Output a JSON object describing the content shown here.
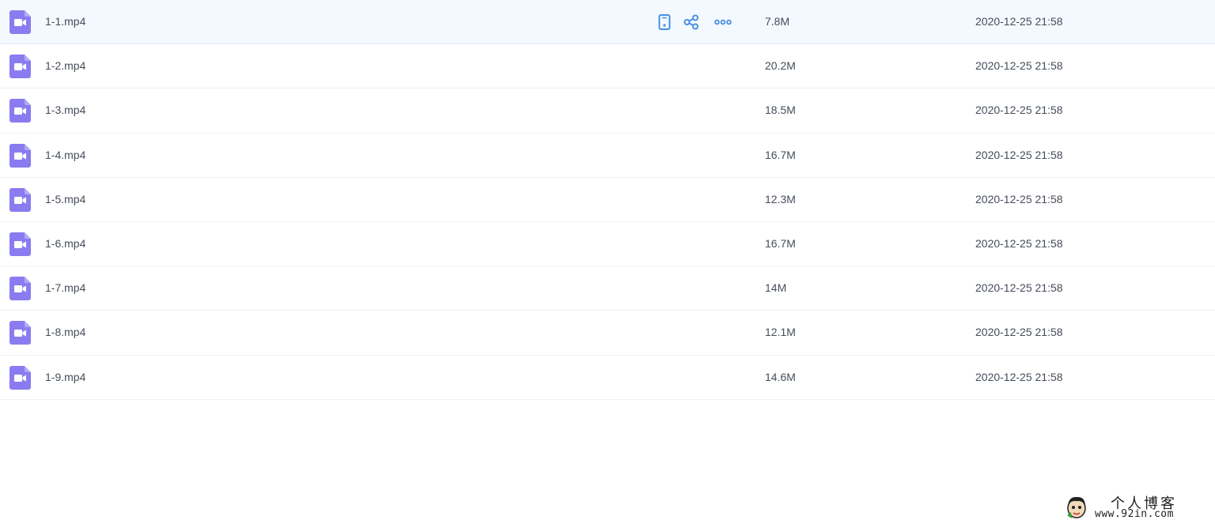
{
  "colors": {
    "accent": "#4a90e2",
    "video_icon": "#8a7cf0",
    "hover_row": "#f3f9fe",
    "text": "#454d5a"
  },
  "row_actions": [
    {
      "name": "phone-icon"
    },
    {
      "name": "share-icon"
    },
    {
      "name": "more-icon"
    }
  ],
  "files": [
    {
      "name": "1-1.mp4",
      "size": "7.8M",
      "date": "2020-12-25 21:58"
    },
    {
      "name": "1-2.mp4",
      "size": "20.2M",
      "date": "2020-12-25 21:58"
    },
    {
      "name": "1-3.mp4",
      "size": "18.5M",
      "date": "2020-12-25 21:58"
    },
    {
      "name": "1-4.mp4",
      "size": "16.7M",
      "date": "2020-12-25 21:58"
    },
    {
      "name": "1-5.mp4",
      "size": "12.3M",
      "date": "2020-12-25 21:58"
    },
    {
      "name": "1-6.mp4",
      "size": "16.7M",
      "date": "2020-12-25 21:58"
    },
    {
      "name": "1-7.mp4",
      "size": "14M",
      "date": "2020-12-25 21:58"
    },
    {
      "name": "1-8.mp4",
      "size": "12.1M",
      "date": "2020-12-25 21:58"
    },
    {
      "name": "1-9.mp4",
      "size": "14.6M",
      "date": "2020-12-25 21:58"
    }
  ],
  "watermark": {
    "title": "个人博客",
    "url": "www.92in.com"
  }
}
